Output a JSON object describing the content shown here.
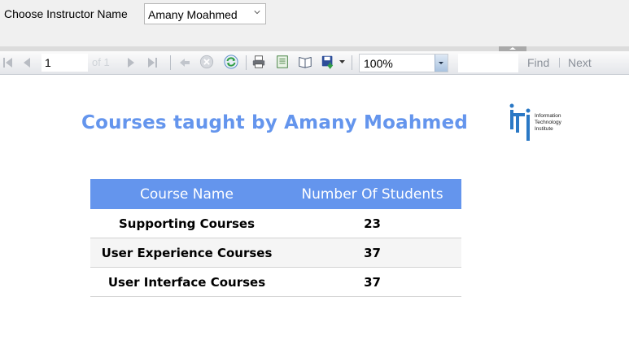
{
  "parameters": {
    "label": "Choose Instructor Name",
    "selected_instructor": "Amany Moahmed"
  },
  "toolbar": {
    "page_number": "1",
    "of_label": "of 1",
    "zoom": "100%",
    "find_value": "",
    "find_label": "Find",
    "next_label": "Next",
    "icons": [
      "first-page-icon",
      "previous-page-icon",
      "next-page-icon",
      "last-page-icon",
      "back-icon",
      "stop-icon",
      "refresh-icon",
      "print-icon",
      "print-layout-icon",
      "page-setup-icon",
      "export-icon"
    ]
  },
  "report": {
    "title": "Courses taught by Amany Moahmed",
    "logo": {
      "line1": "Information",
      "line2": "Technology",
      "line3": "Institute"
    },
    "table": {
      "headers": [
        "Course Name",
        "Number Of Students"
      ],
      "rows": [
        {
          "course": "Supporting Courses",
          "students": "23"
        },
        {
          "course": "User Experience Courses",
          "students": "37"
        },
        {
          "course": "User Interface Courses",
          "students": "37"
        }
      ]
    }
  },
  "colors": {
    "accent": "#6495ed",
    "row_alt": "#f5f5f5"
  }
}
